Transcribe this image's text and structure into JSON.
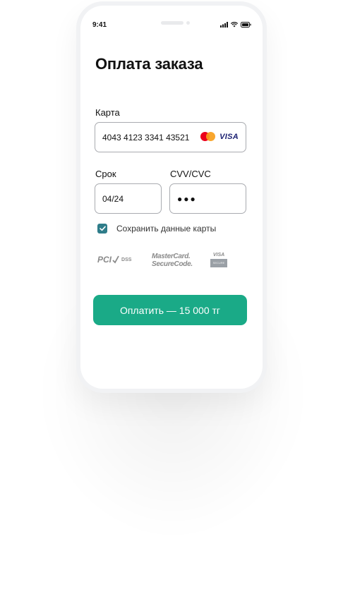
{
  "status_bar": {
    "time": "9:41"
  },
  "page": {
    "title": "Оплата заказа"
  },
  "card": {
    "label": "Карта",
    "number": "4043 4123 3341 43521",
    "brands": {
      "visa": "VISA"
    }
  },
  "expiry": {
    "label": "Срок",
    "value": "04/24"
  },
  "cvv": {
    "label": "CVV/CVC",
    "value": "●●●"
  },
  "save_card": {
    "label": "Сохранить данные карты",
    "checked": true
  },
  "security": {
    "pci": {
      "main": "PCI",
      "sub": "DSS"
    },
    "mastercard_securecode": {
      "line1": "MasterCard.",
      "line2": "SecureCode."
    },
    "verified_by_visa": {
      "top": "VISA",
      "bottom": "SECURE"
    }
  },
  "pay_button": {
    "label": "Оплатить — 15 000 тг"
  },
  "colors": {
    "accent": "#1aaa87",
    "checkbox": "#2f7d8a",
    "mastercard_red": "#eb001b",
    "mastercard_yellow": "#f79e1b",
    "visa_blue": "#1a1f71"
  }
}
